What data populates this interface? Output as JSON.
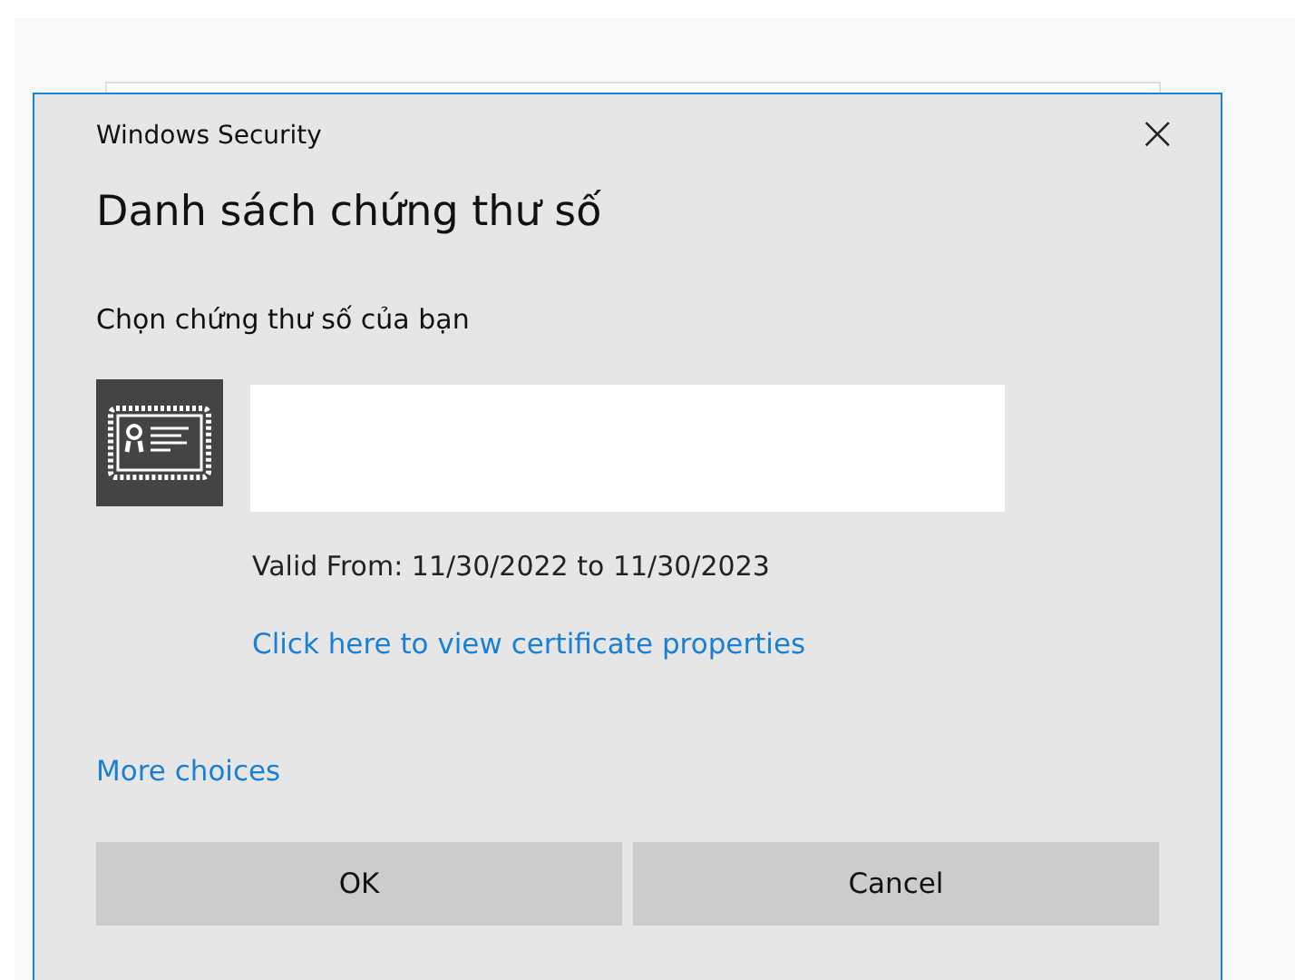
{
  "window": {
    "title": "Windows Security",
    "close": "×"
  },
  "heading": "Danh sách chứng thư số",
  "prompt": "Chọn chứng thư số của bạn",
  "certificate": {
    "validity": "Valid From: 11/30/2022 to 11/30/2023",
    "properties_link": "Click here to view certificate properties"
  },
  "more_choices": "More choices",
  "buttons": [
    "OK",
    "Cancel"
  ]
}
